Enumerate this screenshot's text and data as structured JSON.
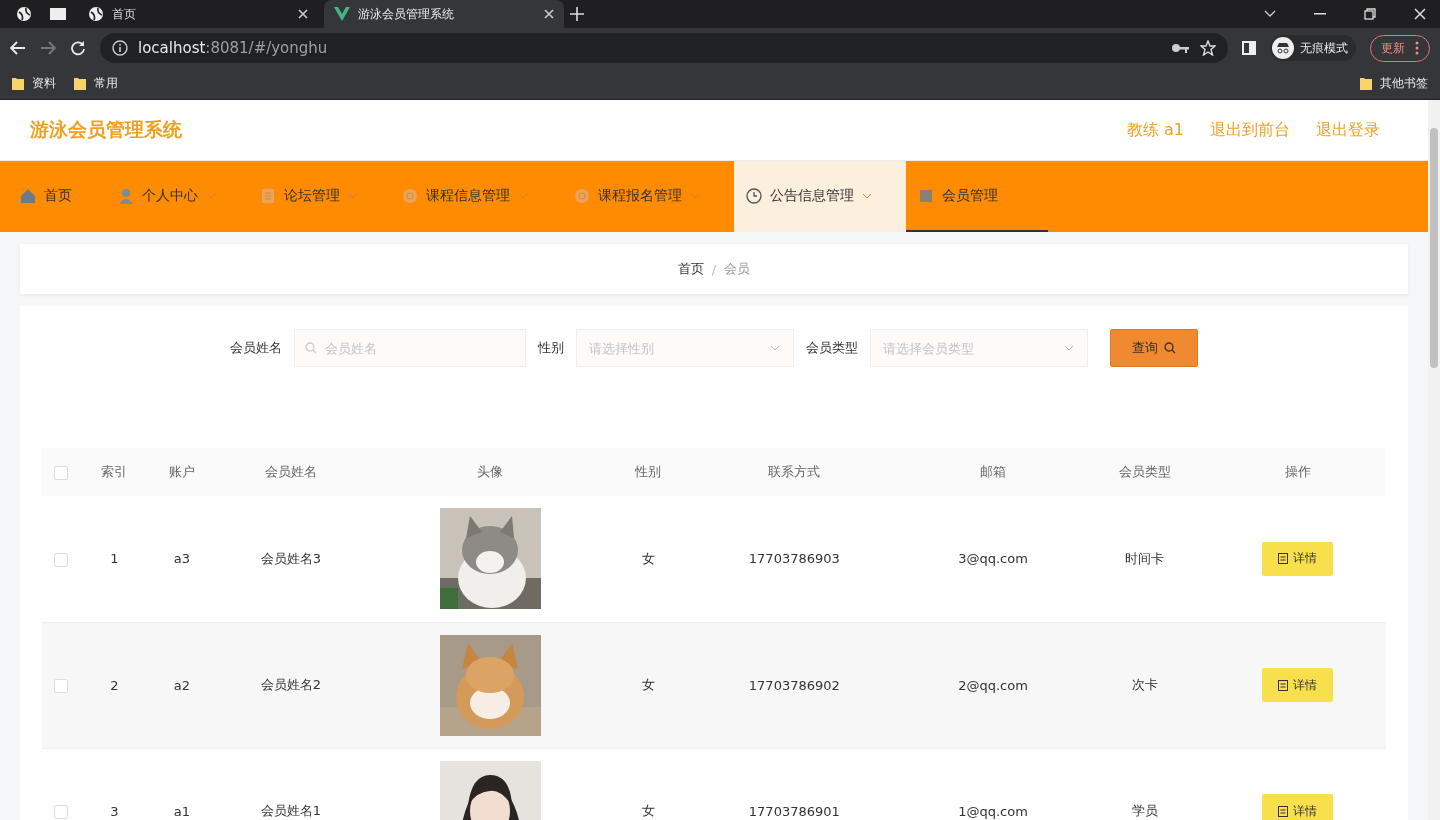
{
  "browser": {
    "tabs": [
      {
        "title": "首页",
        "selected": false
      },
      {
        "title": "游泳会员管理系统",
        "selected": true
      }
    ],
    "address": {
      "host": "localhost",
      "rest": ":8081/#/yonghu"
    },
    "incognito": "无痕模式",
    "update": "更新",
    "bookmarks": [
      "资料",
      "常用"
    ],
    "other_bookmarks": "其他书签"
  },
  "app": {
    "title": "游泳会员管理系统",
    "header_links": [
      "教练 a1",
      "退出到前台",
      "退出登录"
    ],
    "nav": [
      {
        "label": "首页",
        "expandable": false,
        "hovered": false,
        "selected": false
      },
      {
        "label": "个人中心",
        "expandable": true,
        "hovered": false,
        "selected": false
      },
      {
        "label": "论坛管理",
        "expandable": true,
        "hovered": false,
        "selected": false
      },
      {
        "label": "课程信息管理",
        "expandable": true,
        "hovered": false,
        "selected": false
      },
      {
        "label": "课程报名管理",
        "expandable": true,
        "hovered": false,
        "selected": false
      },
      {
        "label": "公告信息管理",
        "expandable": true,
        "hovered": true,
        "selected": false
      },
      {
        "label": "会员管理",
        "expandable": false,
        "hovered": false,
        "selected": true
      }
    ],
    "breadcrumb": {
      "items": [
        "首页",
        "会员"
      ],
      "separator": "/"
    },
    "search": {
      "fields": [
        {
          "label": "会员姓名",
          "placeholder": "会员姓名",
          "kind": "input"
        },
        {
          "label": "性别",
          "placeholder": "请选择性别",
          "kind": "select"
        },
        {
          "label": "会员类型",
          "placeholder": "请选择会员类型",
          "kind": "select"
        }
      ],
      "button": "查询"
    },
    "table": {
      "all_checked": false,
      "columns": [
        "索引",
        "账户",
        "会员姓名",
        "头像",
        "性别",
        "联系方式",
        "邮箱",
        "会员类型",
        "操作"
      ],
      "rows": [
        {
          "checked": false,
          "index": "1",
          "account": "a3",
          "name": "会员姓名3",
          "gender": "女",
          "phone": "17703786903",
          "email": "3@qq.com",
          "type": "时间卡",
          "action": "详情"
        },
        {
          "checked": false,
          "index": "2",
          "account": "a2",
          "name": "会员姓名2",
          "gender": "女",
          "phone": "17703786902",
          "email": "2@qq.com",
          "type": "次卡",
          "action": "详情"
        },
        {
          "checked": false,
          "index": "3",
          "account": "a1",
          "name": "会员姓名1",
          "gender": "女",
          "phone": "17703786901",
          "email": "1@qq.com",
          "type": "学员",
          "action": "详情"
        }
      ]
    }
  }
}
